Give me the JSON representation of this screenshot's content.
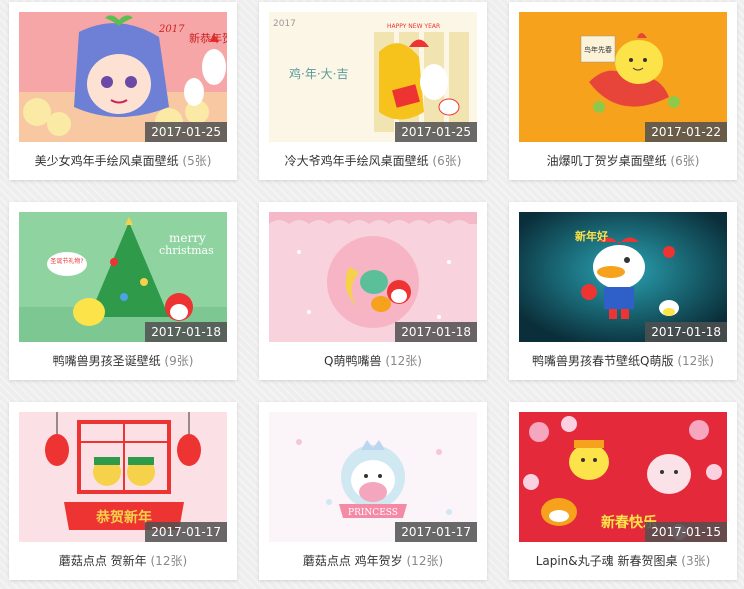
{
  "items": [
    {
      "name": "美少女鸡年手绘风桌面壁纸",
      "count": "(5张)",
      "date": "2017-01-25",
      "color": "#f6a6a6"
    },
    {
      "name": "冷大爷鸡年手绘风桌面壁纸",
      "count": "(6张)",
      "date": "2017-01-25",
      "color": "#fbf6e6"
    },
    {
      "name": "油爆叽丁贺岁桌面壁纸",
      "count": "(6张)",
      "date": "2017-01-22",
      "color": "#f6a21c"
    },
    {
      "name": "鸭嘴兽男孩圣诞壁纸",
      "count": "(9张)",
      "date": "2017-01-18",
      "color": "#8fd3a0"
    },
    {
      "name": "Q萌鸭嘴兽",
      "count": "(12张)",
      "date": "2017-01-18",
      "color": "#f8d2dc"
    },
    {
      "name": "鸭嘴兽男孩春节壁纸Q萌版",
      "count": "(12张)",
      "date": "2017-01-18",
      "color": "#0f4a5a"
    },
    {
      "name": "蘑菇点点 贺新年",
      "count": "(12张)",
      "date": "2017-01-17",
      "color": "#fbe0e6"
    },
    {
      "name": "蘑菇点点 鸡年贺岁",
      "count": "(12张)",
      "date": "2017-01-17",
      "color": "#fbf4f8"
    },
    {
      "name": "Lapin&丸子魂 新春贺图桌",
      "count": "(3张)",
      "date": "2017-01-15",
      "color": "#e42a3a"
    }
  ],
  "thumb_text": {
    "t1_corner": "新恭年贺",
    "t1_year": "2017",
    "t2_year": "2017",
    "t2_hny": "HAPPY NEW YEAR",
    "t2_main": "鸡·年·大·吉",
    "t3_badge": "鸟年先春",
    "t4_merry": "merry",
    "t4_christmas": "christmas",
    "t4_bubble": "圣诞节礼物?",
    "t6_word": "新年好",
    "t7_banner": "恭贺新年",
    "t8_ribbon": "PRINCESS",
    "t9_text": "新春快乐"
  }
}
